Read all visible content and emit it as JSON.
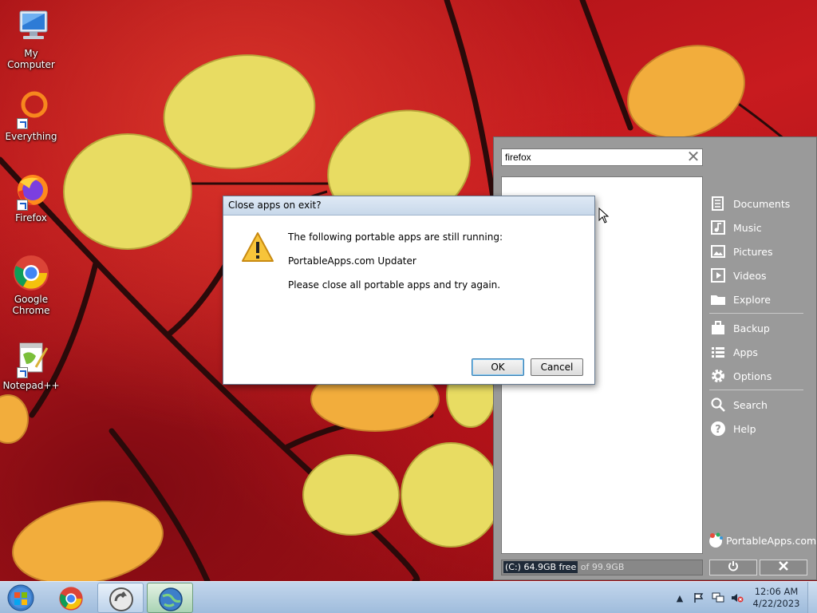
{
  "desktop": {
    "icons": [
      {
        "label": "My Computer",
        "icon": "computer-icon"
      },
      {
        "label": "Everything",
        "icon": "everything-icon"
      },
      {
        "label": "Firefox",
        "icon": "firefox-icon"
      },
      {
        "label": "Google\nChrome",
        "label_line1": "Google",
        "label_line2": "Chrome",
        "icon": "chrome-icon"
      },
      {
        "label": "Notepad++",
        "icon": "notepadpp-icon"
      }
    ]
  },
  "portableapps": {
    "search_value": "firefox",
    "side_menu": [
      {
        "label": "Documents",
        "icon": "documents-icon"
      },
      {
        "label": "Music",
        "icon": "music-icon"
      },
      {
        "label": "Pictures",
        "icon": "pictures-icon"
      },
      {
        "label": "Videos",
        "icon": "videos-icon"
      },
      {
        "label": "Explore",
        "icon": "folder-icon"
      },
      {
        "label": "Backup",
        "icon": "briefcase-icon"
      },
      {
        "label": "Apps",
        "icon": "list-icon"
      },
      {
        "label": "Options",
        "icon": "gear-icon"
      },
      {
        "label": "Search",
        "icon": "search-icon"
      },
      {
        "label": "Help",
        "icon": "help-icon"
      }
    ],
    "brand": "PortableApps.com",
    "status_drive": "(C:) 64.9GB free",
    "status_rest": " of 99.9GB"
  },
  "dialog": {
    "title": "Close apps on exit?",
    "line1": "The following portable apps are still running:",
    "line2": "PortableApps.com Updater",
    "line3": "Please close all portable apps and try again.",
    "ok_label": "OK",
    "cancel_label": "Cancel"
  },
  "taskbar": {
    "time": "12:06 AM",
    "date": "4/22/2023"
  }
}
